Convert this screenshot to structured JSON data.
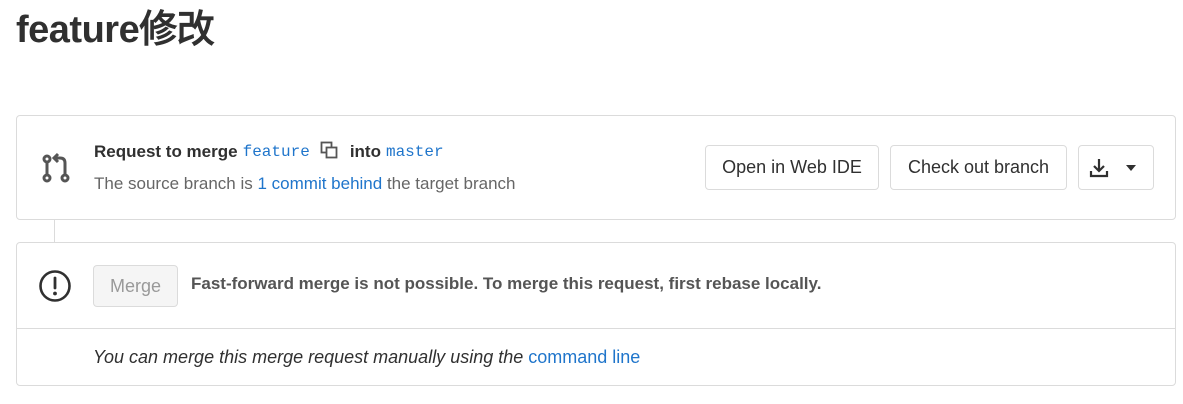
{
  "page": {
    "title": "feature修改"
  },
  "merge_request": {
    "request_prefix": "Request to merge",
    "source_branch": "feature",
    "into_text": "into",
    "target_branch": "master",
    "status_prefix": "The source branch is",
    "status_link": "1 commit behind",
    "status_suffix": "the target branch",
    "icon": "merge-request-icon",
    "copy_icon": "copy-icon"
  },
  "actions": {
    "open_web_ide": "Open in Web IDE",
    "check_out_branch": "Check out branch",
    "download_icon": "download-icon",
    "dropdown_icon": "chevron-down-icon"
  },
  "merge_widget": {
    "alert_icon": "alert-circle-icon",
    "merge_label": "Merge",
    "message": "Fast-forward merge is not possible. To merge this request, first rebase locally.",
    "manual_text": "You can merge this merge request manually using the",
    "manual_link": "command line"
  },
  "colors": {
    "link": "#1f75cb",
    "text": "#303030",
    "muted": "#666666",
    "border": "#dbdbdb"
  }
}
